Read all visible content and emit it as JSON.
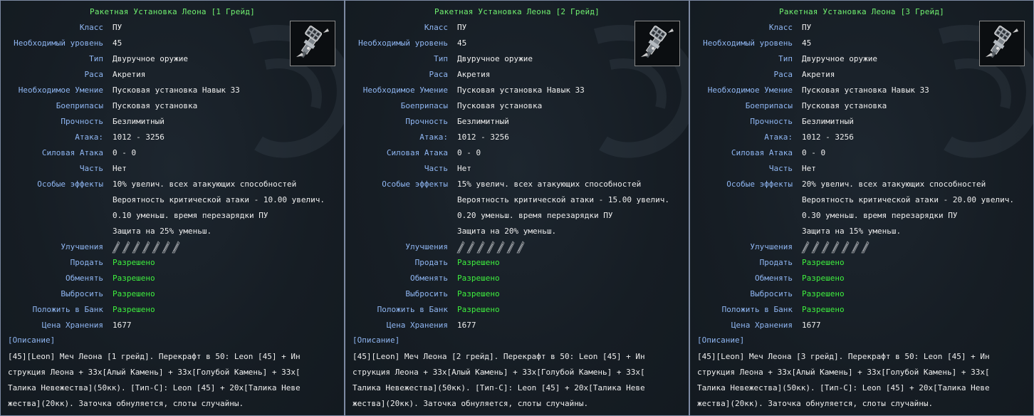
{
  "labels": {
    "class": "Класс",
    "level": "Необходимый уровень",
    "type": "Тип",
    "race": "Раса",
    "skill": "Необходимое Умение",
    "ammo": "Боеприпасы",
    "durability": "Прочность",
    "attack": "Атака:",
    "force_attack": "Силовая Атака",
    "part": "Часть",
    "effects": "Особые эффекты",
    "upgrades": "Улучшения",
    "sell": "Продать",
    "trade": "Обменять",
    "drop": "Выбросить",
    "bank": "Положить в Банк",
    "storage": "Цена Хранения",
    "description": "[Описание]"
  },
  "icon": "rocket-launcher-icon",
  "upgrade_slot_icon": "upgrade-slot-icon",
  "panels": [
    {
      "title": "Ракетная Установка Леона [1 Грейд]",
      "class": "ПУ",
      "level": "45",
      "type": "Двуручное оружие",
      "race": "Акретия",
      "skill": "Пусковая установка Навык 33",
      "ammo": "Пусковая установка",
      "durability": "Безлимитный",
      "attack": "1012 - 3256",
      "force_attack": "0 - 0",
      "part": "Нет",
      "effects": [
        "10% увелич. всех атакующих способностей",
        "Вероятность критической атаки - 10.00 увелич.",
        "0.10 уменьш. время перезарядки ПУ",
        "Защита на 25% уменьш."
      ],
      "sell": "Разрешено",
      "trade": "Разрешено",
      "drop": "Разрешено",
      "bank": "Разрешено",
      "storage": "1677",
      "description": "[45][Leon] Меч Леона [1 грейд]. Перекрафт в 50: Leon [45] + Ин\nструкция Леона + 33x[Алый Камень] + 33x[Голубой Камень] + 33x[\nТалика Невежества](50кк). [Тип-C]: Leon [45] + 20x[Талика Неве\nжества](20кк). Заточка обнуляется, слоты случайны."
    },
    {
      "title": "Ракетная Установка Леона [2 Грейд]",
      "class": "ПУ",
      "level": "45",
      "type": "Двуручное оружие",
      "race": "Акретия",
      "skill": "Пусковая установка Навык 33",
      "ammo": "Пусковая установка",
      "durability": "Безлимитный",
      "attack": "1012 - 3256",
      "force_attack": "0 - 0",
      "part": "Нет",
      "effects": [
        "15% увелич. всех атакующих способностей",
        "Вероятность критической атаки - 15.00 увелич.",
        "0.20 уменьш. время перезарядки ПУ",
        "Защита на 20% уменьш."
      ],
      "sell": "Разрешено",
      "trade": "Разрешено",
      "drop": "Разрешено",
      "bank": "Разрешено",
      "storage": "1677",
      "description": "[45][Leon] Меч Леона [2 грейд]. Перекрафт в 50: Leon [45] + Ин\nструкция Леона + 33x[Алый Камень] + 33x[Голубой Камень] + 33x[\nТалика Невежества](50кк). [Тип-C]: Leon [45] + 20x[Талика Неве\nжества](20кк). Заточка обнуляется, слоты случайны."
    },
    {
      "title": "Ракетная Установка Леона [3 Грейд]",
      "class": "ПУ",
      "level": "45",
      "type": "Двуручное оружие",
      "race": "Акретия",
      "skill": "Пусковая установка Навык 33",
      "ammo": "Пусковая установка",
      "durability": "Безлимитный",
      "attack": "1012 - 3256",
      "force_attack": "0 - 0",
      "part": "Нет",
      "effects": [
        "20% увелич. всех атакующих способностей",
        "Вероятность критической атаки - 20.00 увелич.",
        "0.30 уменьш. время перезарядки ПУ",
        "Защита на 15% уменьш."
      ],
      "sell": "Разрешено",
      "trade": "Разрешено",
      "drop": "Разрешено",
      "bank": "Разрешено",
      "storage": "1677",
      "description": "[45][Leon] Меч Леона [3 грейд]. Перекрафт в 50: Leon [45] + Ин\nструкция Леона + 33x[Алый Камень] + 33x[Голубой Камень] + 33x[\nТалика Невежества](50кк). [Тип-C]: Leon [45] + 20x[Талика Неве\nжества](20кк). Заточка обнуляется, слоты случайны."
    }
  ]
}
